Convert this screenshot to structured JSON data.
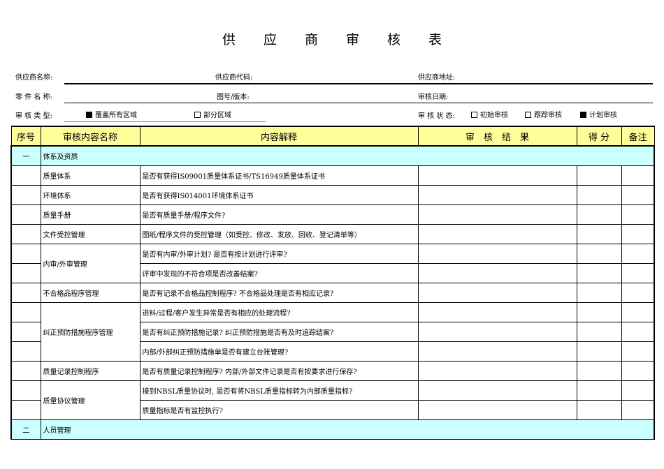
{
  "title": "供应商审核表",
  "fields": {
    "supplier_name": "供应商名称:",
    "supplier_code": "供应商代码:",
    "supplier_address": "供应商地址:",
    "part_name": "零 件 名 称:",
    "drawing_version": "图号/版本:",
    "audit_date": "审核日期:",
    "audit_type": "审 核 类 型:",
    "audit_type_options": [
      {
        "label": "覆盖所有区域",
        "checked": true
      },
      {
        "label": "部分区域",
        "checked": false
      }
    ],
    "audit_status": "审 核 状 态:",
    "audit_status_options": [
      {
        "label": "初始审核",
        "checked": false
      },
      {
        "label": "跟踪审核",
        "checked": false
      },
      {
        "label": "计划审核",
        "checked": true
      }
    ]
  },
  "table": {
    "headers": [
      "序号",
      "审核内容名称",
      "内容解释",
      "审　核　结　果",
      "得 分",
      "备注"
    ],
    "sections": [
      {
        "seq": "一",
        "name": "体系及资质"
      },
      {
        "seq": "二",
        "name": "人员管理"
      }
    ],
    "items": [
      {
        "name": "质量体系",
        "details": [
          "是否有获得IS09001质量体系证书/TS16949质量体系证书"
        ]
      },
      {
        "name": "环境体系",
        "details": [
          "是否有获得IS014001环境体系证书"
        ]
      },
      {
        "name": "质量手册",
        "details": [
          "是否有质量手册/程序文件?"
        ]
      },
      {
        "name": "文件受控管理",
        "details": [
          "图纸/程序文件的受控管理（如受控、修改、发放、回收、登记清单等）"
        ]
      },
      {
        "name": "内审/外审管理",
        "details": [
          "是否有内审/外审计划? 是否有按计划进行评审?",
          "评审中发现的不符合项是否改善结案?"
        ]
      },
      {
        "name": "不合格品程序管理",
        "details": [
          "是否有记录不合格品控制程序? 不合格品处理是否有相应记录?"
        ]
      },
      {
        "name": "纠正预防措施程序管理",
        "details": [
          "进料/过程/客户发生异常是否有相应的处理流程?",
          "是否有纠正预防措施记录? 纠正预防措施是否有及时追踪结案?",
          "内部/外部纠正预防措施单是否有建立台账管理?"
        ]
      },
      {
        "name": "质量记录控制程序",
        "details": [
          "是否有质量记录控制程序? 内部/外部文件记录是否有按要求进行保存?"
        ]
      },
      {
        "name": "质量协议管理",
        "details": [
          "接到NBSL质量协议时, 是否有将NBSL质量指标转为内部质量指标?",
          "质量指标是否有监控执行?"
        ]
      }
    ]
  }
}
